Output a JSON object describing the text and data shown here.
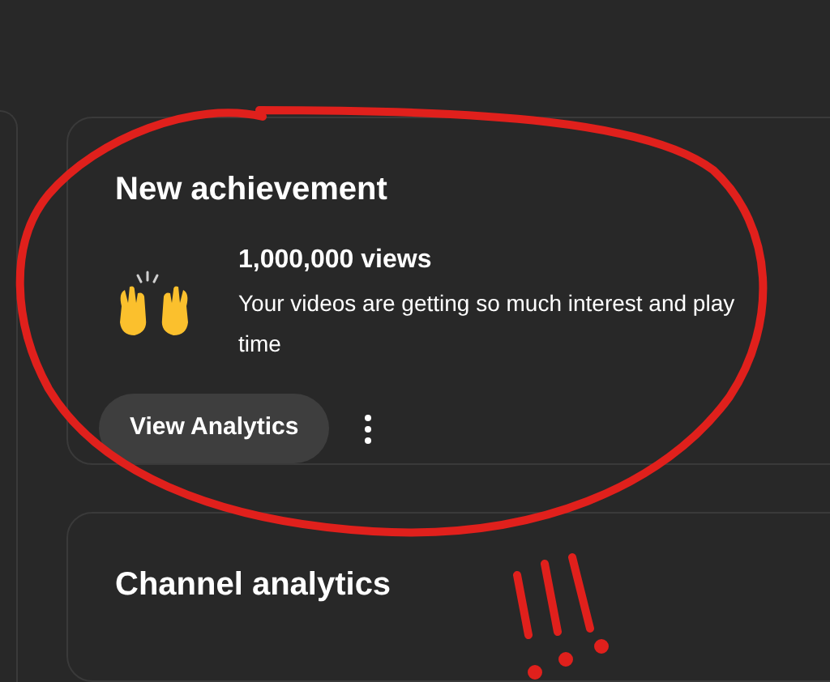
{
  "achievement_card": {
    "title": "New achievement",
    "milestone": "1,000,000 views",
    "message": "Your videos are getting so much interest and play time",
    "button": "View Analytics"
  },
  "analytics_card": {
    "title": "Channel analytics"
  }
}
